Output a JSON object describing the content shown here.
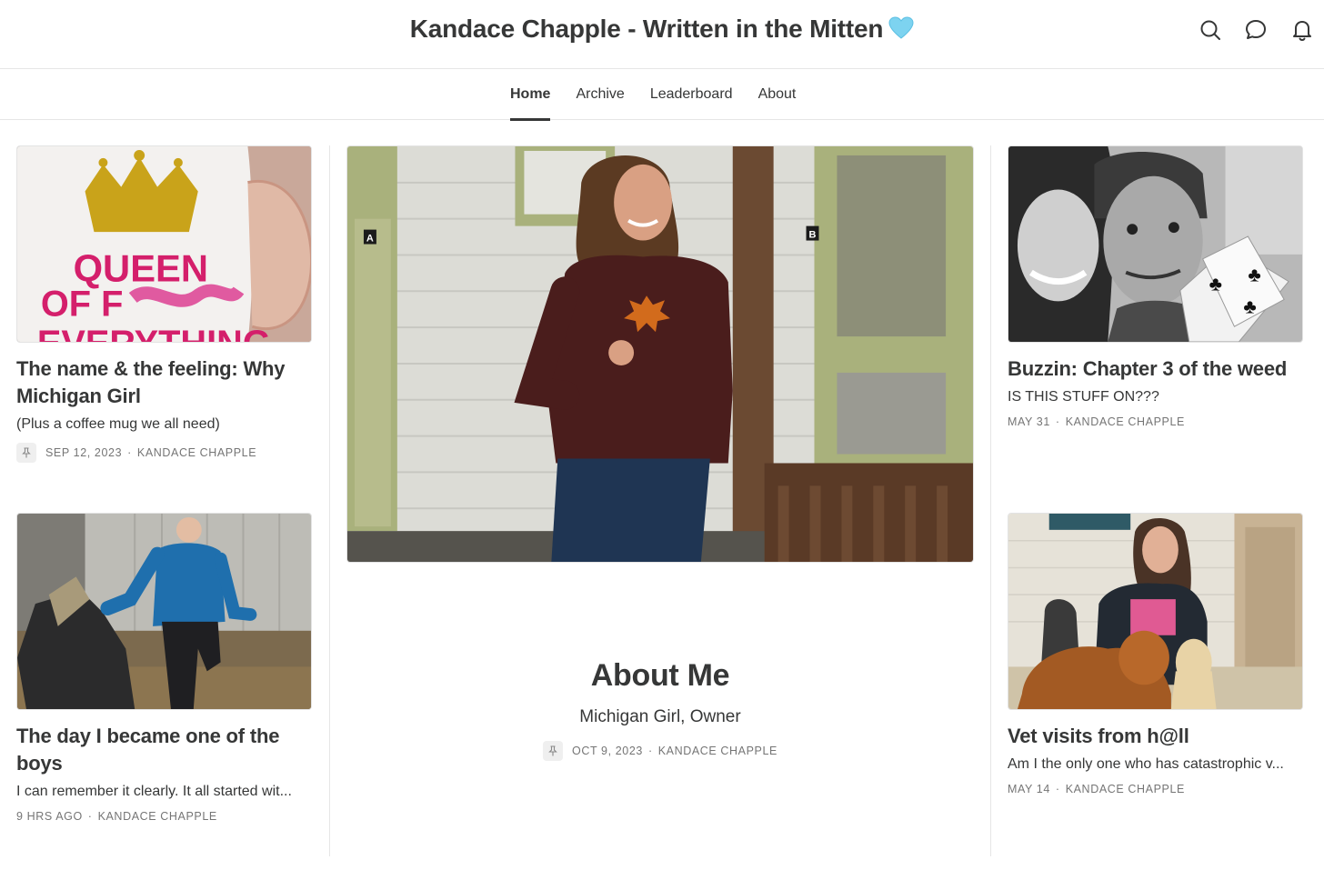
{
  "header": {
    "title": "Kandace Chapple - Written in the Mitten",
    "title_emoji": "light-blue-heart-icon",
    "icons": [
      "search-icon",
      "chat-bubble-icon",
      "bell-icon"
    ]
  },
  "nav": {
    "tabs": [
      {
        "label": "Home",
        "active": true
      },
      {
        "label": "Archive",
        "active": false
      },
      {
        "label": "Leaderboard",
        "active": false
      },
      {
        "label": "About",
        "active": false
      }
    ]
  },
  "posts": {
    "left_top": {
      "title": "The name & the feeling: Why Michigan Girl",
      "subtitle": "(Plus a coffee mug we all need)",
      "date": "SEP 12, 2023",
      "author": "KANDACE CHAPPLE",
      "pinned": true,
      "image_text": [
        "QUEEN",
        "OF F",
        "EVERYTHING"
      ]
    },
    "left_bottom": {
      "title": "The day I became one of the boys",
      "subtitle": "I can remember it clearly. It all started wit...",
      "date": "9 HRS AGO",
      "author": "KANDACE CHAPPLE",
      "pinned": false
    },
    "featured": {
      "title": "About Me",
      "subtitle": "Michigan Girl, Owner",
      "date": "OCT 9, 2023",
      "author": "KANDACE CHAPPLE",
      "pinned": true,
      "door_labels": [
        "A",
        "B"
      ]
    },
    "right_top": {
      "title": "Buzzin: Chapter 3 of the weed",
      "subtitle": "IS THIS STUFF ON???",
      "date": "MAY 31",
      "author": "KANDACE CHAPPLE",
      "pinned": false
    },
    "right_bottom": {
      "title": "Vet visits from h@ll",
      "subtitle": "Am I the only one who has catastrophic v...",
      "date": "MAY 14",
      "author": "KANDACE CHAPPLE",
      "pinned": false
    }
  },
  "colors": {
    "text": "#363737",
    "meta": "#757575",
    "divider": "#e6e6e6",
    "heart": "#7dd3f0"
  }
}
